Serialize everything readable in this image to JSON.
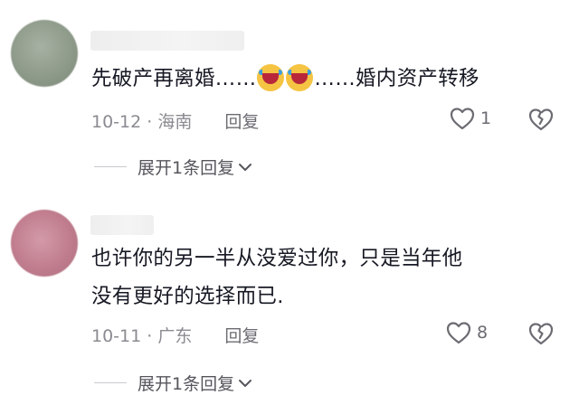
{
  "comments": [
    {
      "text_before": "先破产再离婚……",
      "emojis": [
        "crying-laughing-emoji",
        "crying-laughing-emoji"
      ],
      "text_after": "……婚内资产转移",
      "date": "10-12",
      "location": "海南",
      "reply_label": "回复",
      "likes": "1",
      "expand_label": "展开1条回复"
    },
    {
      "text_line1": "也许你的另一半从没爱过你，只是当年他",
      "text_line2": "没有更好的选择而已.",
      "date": "10-11",
      "location": "广东",
      "reply_label": "回复",
      "likes": "8",
      "expand_label": "展开1条回复"
    }
  ],
  "separator": "·",
  "colors": {
    "text": "#161823",
    "meta": "#8a8b91",
    "icon": "#6b6c72"
  }
}
